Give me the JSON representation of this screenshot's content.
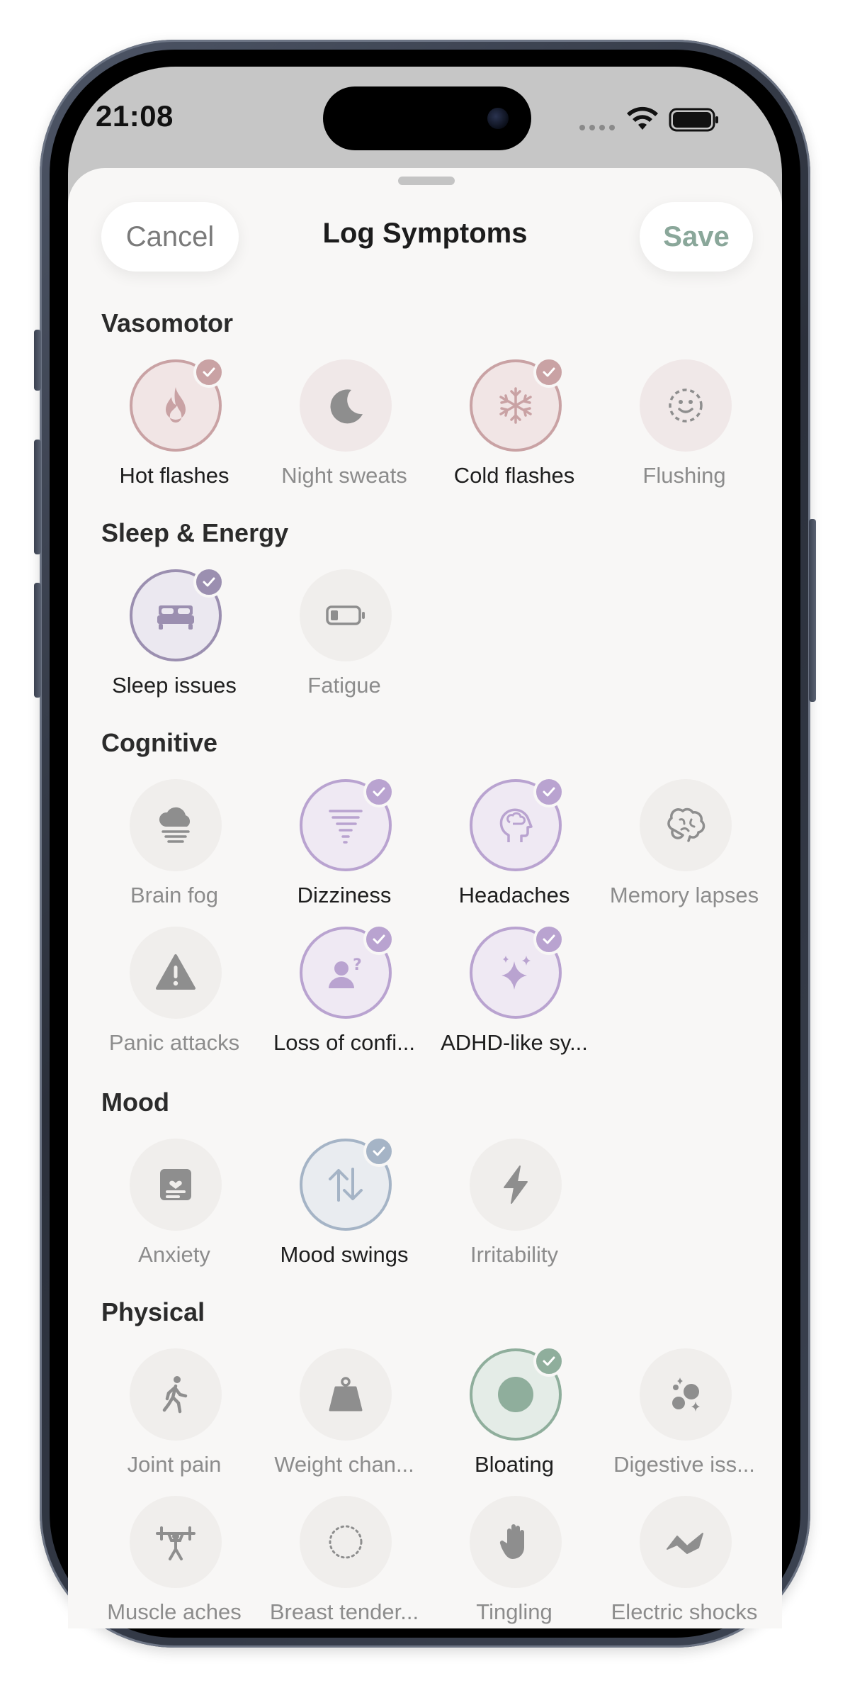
{
  "status_bar": {
    "time": "21:08"
  },
  "sheet": {
    "title": "Log Symptoms",
    "cancel_label": "Cancel",
    "save_label": "Save"
  },
  "sections": [
    {
      "title": "Vasomotor",
      "items": [
        {
          "label": "Hot flashes",
          "icon": "flame-icon",
          "selected": true
        },
        {
          "label": "Night sweats",
          "icon": "moon-icon",
          "selected": false
        },
        {
          "label": "Cold flashes",
          "icon": "snowflake-icon",
          "selected": true
        },
        {
          "label": "Flushing",
          "icon": "smiley-dashed-icon",
          "selected": false
        }
      ]
    },
    {
      "title": "Sleep & Energy",
      "items": [
        {
          "label": "Sleep issues",
          "icon": "bed-icon",
          "selected": true
        },
        {
          "label": "Fatigue",
          "icon": "battery-low-icon",
          "selected": false
        }
      ]
    },
    {
      "title": "Cognitive",
      "items": [
        {
          "label": "Brain fog",
          "icon": "fog-cloud-icon",
          "selected": false
        },
        {
          "label": "Dizziness",
          "icon": "tornado-icon",
          "selected": true
        },
        {
          "label": "Headaches",
          "icon": "head-brain-icon",
          "selected": true
        },
        {
          "label": "Memory lapses",
          "icon": "brain-icon",
          "selected": false
        },
        {
          "label": "Panic attacks",
          "icon": "warning-icon",
          "selected": false
        },
        {
          "label": "Loss of confi...",
          "icon": "person-question-icon",
          "selected": true
        },
        {
          "label": "ADHD-like sy...",
          "icon": "sparkles-icon",
          "selected": true
        }
      ]
    },
    {
      "title": "Mood",
      "items": [
        {
          "label": "Anxiety",
          "icon": "heart-note-icon",
          "selected": false
        },
        {
          "label": "Mood swings",
          "icon": "arrows-up-down-icon",
          "selected": true
        },
        {
          "label": "Irritability",
          "icon": "bolt-icon",
          "selected": false
        }
      ]
    },
    {
      "title": "Physical",
      "items": [
        {
          "label": "Joint pain",
          "icon": "walking-figure-icon",
          "selected": false
        },
        {
          "label": "Weight chan...",
          "icon": "weight-icon",
          "selected": false
        },
        {
          "label": "Bloating",
          "icon": "circle-dot-icon",
          "selected": true
        },
        {
          "label": "Digestive iss...",
          "icon": "bubbles-sparkle-icon",
          "selected": false
        },
        {
          "label": "Muscle aches",
          "icon": "weightlifter-icon",
          "selected": false
        },
        {
          "label": "Breast tender...",
          "icon": "dotted-circle-icon",
          "selected": false
        },
        {
          "label": "Tingling",
          "icon": "hand-icon",
          "selected": false
        },
        {
          "label": "Electric shocks",
          "icon": "zigzag-icon",
          "selected": false
        }
      ]
    }
  ]
}
